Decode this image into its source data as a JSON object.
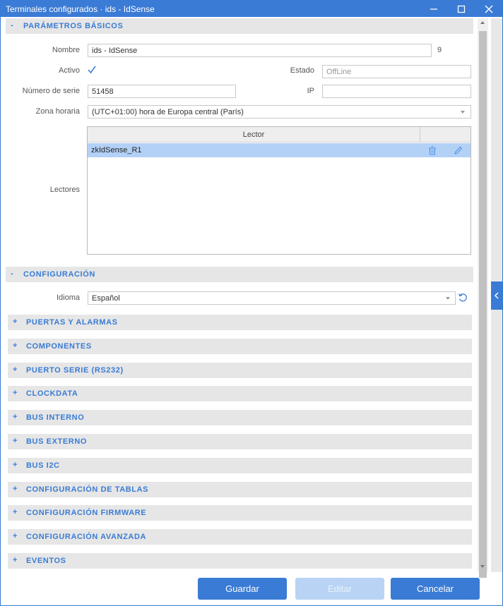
{
  "window": {
    "title": "Terminales configurados · ids - IdSense"
  },
  "basic": {
    "sign": "-",
    "header": "PARÁMETROS BÁSICOS",
    "nombre_label": "Nombre",
    "nombre_value": "ids - IdSense",
    "nombre_count": "9",
    "activo_label": "Activo",
    "activo_checked": true,
    "estado_label": "Estado",
    "estado_value": "OffLine",
    "serie_label": "Número de serie",
    "serie_value": "51458",
    "ip_label": "IP",
    "ip_value": "",
    "zona_label": "Zona horaria",
    "zona_value": "(UTC+01:00) hora de Europa central (París)",
    "lectores_label": "Lectores",
    "grid": {
      "column": "Lector",
      "rows": [
        {
          "name": "zkIdSense_R1"
        }
      ]
    }
  },
  "config": {
    "sign": "-",
    "header": "CONFIGURACIÓN",
    "idioma_label": "Idioma",
    "idioma_value": "Español"
  },
  "collapsed_sections": [
    {
      "sign": "+",
      "label": "PUERTAS Y ALARMAS"
    },
    {
      "sign": "+",
      "label": "COMPONENTES"
    },
    {
      "sign": "+",
      "label": "PUERTO SERIE (RS232)"
    },
    {
      "sign": "+",
      "label": "CLOCKDATA"
    },
    {
      "sign": "+",
      "label": "BUS INTERNO"
    },
    {
      "sign": "+",
      "label": "BUS EXTERNO"
    },
    {
      "sign": "+",
      "label": "BUS I2C"
    },
    {
      "sign": "+",
      "label": "CONFIGURACIÓN DE TABLAS"
    },
    {
      "sign": "+",
      "label": "CONFIGURACIÓN FIRMWARE"
    },
    {
      "sign": "+",
      "label": "CONFIGURACIÓN AVANZADA"
    },
    {
      "sign": "+",
      "label": "EVENTOS"
    }
  ],
  "buttons": {
    "save": "Guardar",
    "edit": "Editar",
    "cancel": "Cancelar"
  },
  "colors": {
    "accent": "#3a7bd5",
    "selected_row": "#b3d1f7",
    "disabled_button": "#b8d3f4"
  }
}
